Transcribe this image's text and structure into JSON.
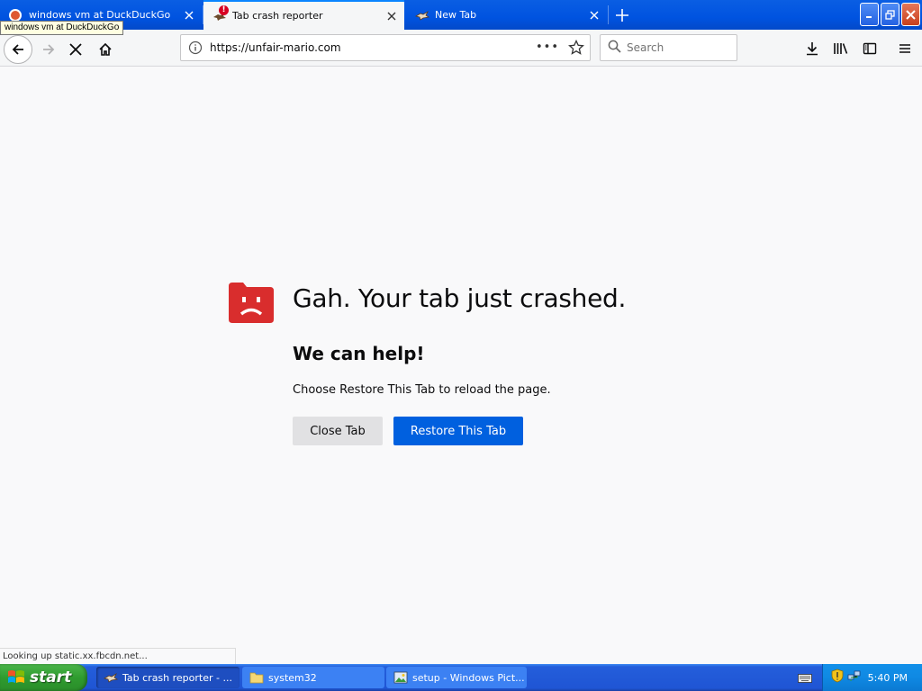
{
  "tabs": [
    {
      "title": "windows vm at DuckDuckGo",
      "favicon": "duckduckgo-icon",
      "active": false
    },
    {
      "title": "Tab crash reporter",
      "favicon": "crashed-bird-icon",
      "active": true
    },
    {
      "title": "New Tab",
      "favicon": "bird-icon",
      "active": false
    }
  ],
  "tooltip": "windows vm at DuckDuckGo",
  "navbar": {
    "url": "https://unfair-mario.com",
    "more_label": "•••",
    "search_placeholder": "Search"
  },
  "crash": {
    "title": "Gah. Your tab just crashed.",
    "subtitle": "We can help!",
    "description": "Choose Restore This Tab to reload the page.",
    "close_label": "Close Tab",
    "restore_label": "Restore This Tab"
  },
  "status_text": "Looking up static.xx.fbcdn.net...",
  "taskbar": {
    "start_label": "start",
    "tasks": [
      {
        "label": "Tab crash reporter - ...",
        "icon": "firefox-icon"
      },
      {
        "label": "system32",
        "icon": "folder-icon"
      },
      {
        "label": "setup - Windows Pict...",
        "icon": "picture-viewer-icon"
      }
    ],
    "clock": "5:40 PM"
  },
  "colors": {
    "accent": "#0060df",
    "crash_icon": "#d92d2d",
    "xp_blue": "#245edb"
  }
}
